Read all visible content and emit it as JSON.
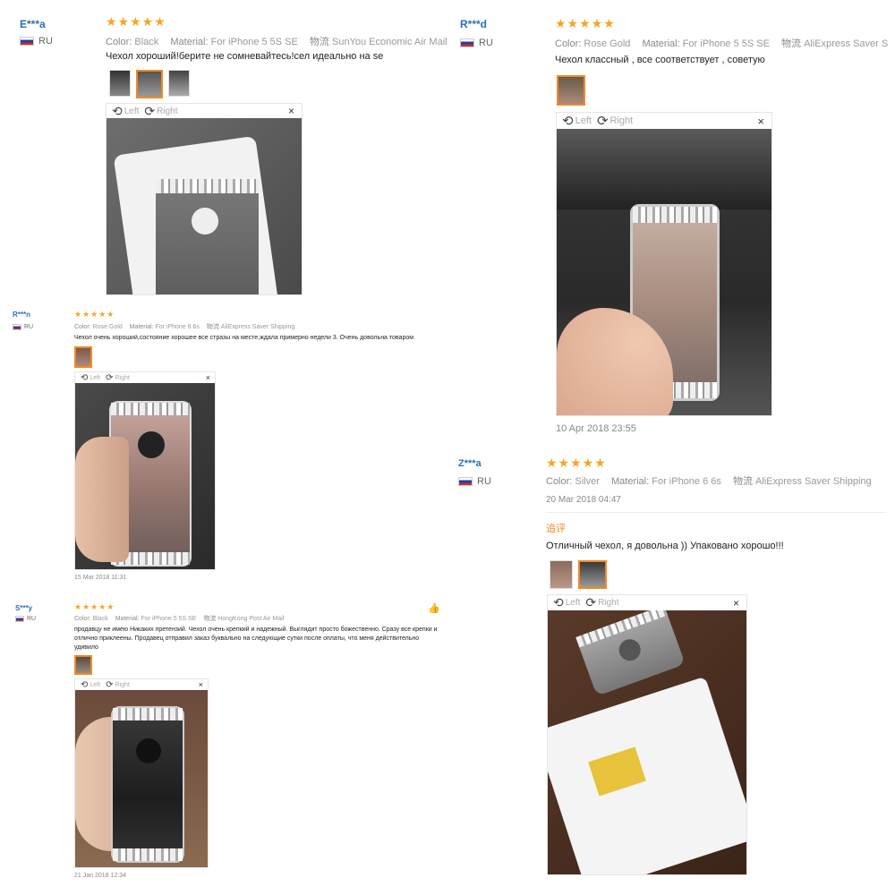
{
  "reviews": {
    "r1": {
      "user": "E***a",
      "country": "RU",
      "stars": "★★★★★",
      "color_label": "Color:",
      "color": "Black",
      "material_label": "Material:",
      "material": "For iPhone 5 5S SE",
      "shipping_label": "物流",
      "shipping": "SunYou Economic Air Mail",
      "text": "Чехол хороший!берите не сомневайтесь!сел идеально на se",
      "viewer": {
        "left": "Left",
        "right": "Right",
        "close": "×"
      }
    },
    "r2": {
      "user": "R***d",
      "country": "RU",
      "stars": "★★★★★",
      "color_label": "Color:",
      "color": "Rose Gold",
      "material_label": "Material:",
      "material": "For iPhone 5 5S SE",
      "shipping_label": "物流",
      "shipping": "AliExpress Saver S",
      "text": "Чехол классный , все соответствует , советую",
      "viewer": {
        "left": "Left",
        "right": "Right",
        "close": "×"
      },
      "date": "10 Apr 2018 23:55"
    },
    "r3": {
      "user": "R***n",
      "country": "RU",
      "stars": "★★★★★",
      "color_label": "Color:",
      "color": "Rose Gold",
      "material_label": "Material:",
      "material": "For iPhone 6 6s",
      "shipping_label": "物流",
      "shipping": "AliExpress Saver Shipping",
      "text": "Чехол очень хороший,состояние хорошее все стразы на месте,ждала примерно недели 3. Очень довольна товаром",
      "viewer": {
        "left": "Left",
        "right": "Right",
        "close": "×"
      },
      "date": "15 Mar 2018 11:31"
    },
    "r4": {
      "user": "Z***a",
      "country": "RU",
      "stars": "★★★★★",
      "color_label": "Color:",
      "color": "Silver",
      "material_label": "Material:",
      "material": "For iPhone 6 6s",
      "shipping_label": "物流",
      "shipping": "AliExpress Saver Shipping",
      "date": "20 Mar 2018 04:47",
      "followup": "追评",
      "text": "Отличный чехол, я довольна )) Упаковано хорошо!!!",
      "viewer": {
        "left": "Left",
        "right": "Right",
        "close": "×"
      }
    },
    "r5": {
      "user": "S***y",
      "country": "RU",
      "stars": "★★★★★",
      "color_label": "Color:",
      "color": "Black",
      "material_label": "Material:",
      "material": "For iPhone 5 5S SE",
      "shipping_label": "物流",
      "shipping": "HongKong Post Air Mail",
      "text": "продавцу не имею Никаких претензий. Чехол очень крепкий и надежный. Выглядит просто божественно. Сразу все крепки и отлично приклеены. Продавец отправил заказ буквально на следующие сутки после оплаты, что меня действительно удивило",
      "viewer": {
        "left": "Left",
        "right": "Right",
        "close": "×"
      },
      "date": "21 Jan 2018 12:34"
    }
  },
  "icons": {
    "rotate_left": "⟲",
    "rotate_right": "⟳",
    "thumbs_up": "👍"
  },
  "colors": {
    "accent": "#f08a24",
    "star": "#f5a623",
    "user": "#2a6ebb"
  }
}
